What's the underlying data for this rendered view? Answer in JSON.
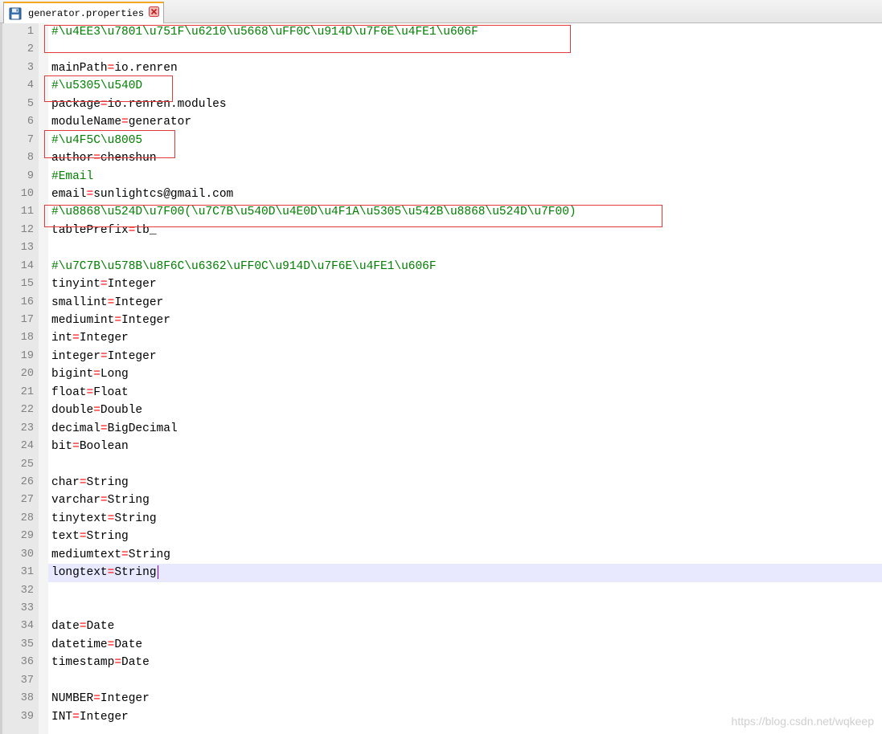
{
  "tab": {
    "title": "generator.properties",
    "save_icon": "floppy-save-icon",
    "close_icon": "close-x-icon"
  },
  "colors": {
    "comment": "#008000",
    "operator": "#ff0000",
    "text": "#000000",
    "line_number": "#808080",
    "current_line": "#e8e8ff",
    "highlight_box": "#e03a3a"
  },
  "lines": [
    {
      "num": "1",
      "kind": "comment",
      "text": "#\\u4EE3\\u7801\\u751F\\u6210\\u5668\\uFF0C\\u914D\\u7F6E\\u4FE1\\u606F"
    },
    {
      "num": "2",
      "kind": "blank",
      "text": ""
    },
    {
      "num": "3",
      "kind": "prop",
      "key": "mainPath",
      "value": "io.renren"
    },
    {
      "num": "4",
      "kind": "comment",
      "text": "#\\u5305\\u540D"
    },
    {
      "num": "5",
      "kind": "prop",
      "key": "package",
      "value": "io.renren.modules"
    },
    {
      "num": "6",
      "kind": "prop",
      "key": "moduleName",
      "value": "generator"
    },
    {
      "num": "7",
      "kind": "comment",
      "text": "#\\u4F5C\\u8005"
    },
    {
      "num": "8",
      "kind": "prop",
      "key": "author",
      "value": "chenshun"
    },
    {
      "num": "9",
      "kind": "comment",
      "text": "#Email"
    },
    {
      "num": "10",
      "kind": "prop",
      "key": "email",
      "value": "sunlightcs@gmail.com"
    },
    {
      "num": "11",
      "kind": "comment",
      "text": "#\\u8868\\u524D\\u7F00(\\u7C7B\\u540D\\u4E0D\\u4F1A\\u5305\\u542B\\u8868\\u524D\\u7F00)"
    },
    {
      "num": "12",
      "kind": "prop",
      "key": "tablePrefix",
      "value": "tb_"
    },
    {
      "num": "13",
      "kind": "blank",
      "text": ""
    },
    {
      "num": "14",
      "kind": "comment",
      "text": "#\\u7C7B\\u578B\\u8F6C\\u6362\\uFF0C\\u914D\\u7F6E\\u4FE1\\u606F"
    },
    {
      "num": "15",
      "kind": "prop",
      "key": "tinyint",
      "value": "Integer"
    },
    {
      "num": "16",
      "kind": "prop",
      "key": "smallint",
      "value": "Integer"
    },
    {
      "num": "17",
      "kind": "prop",
      "key": "mediumint",
      "value": "Integer"
    },
    {
      "num": "18",
      "kind": "prop",
      "key": "int",
      "value": "Integer"
    },
    {
      "num": "19",
      "kind": "prop",
      "key": "integer",
      "value": "Integer"
    },
    {
      "num": "20",
      "kind": "prop",
      "key": "bigint",
      "value": "Long"
    },
    {
      "num": "21",
      "kind": "prop",
      "key": "float",
      "value": "Float"
    },
    {
      "num": "22",
      "kind": "prop",
      "key": "double",
      "value": "Double"
    },
    {
      "num": "23",
      "kind": "prop",
      "key": "decimal",
      "value": "BigDecimal"
    },
    {
      "num": "24",
      "kind": "prop",
      "key": "bit",
      "value": "Boolean"
    },
    {
      "num": "25",
      "kind": "blank",
      "text": ""
    },
    {
      "num": "26",
      "kind": "prop",
      "key": "char",
      "value": "String"
    },
    {
      "num": "27",
      "kind": "prop",
      "key": "varchar",
      "value": "String"
    },
    {
      "num": "28",
      "kind": "prop",
      "key": "tinytext",
      "value": "String"
    },
    {
      "num": "29",
      "kind": "prop",
      "key": "text",
      "value": "String"
    },
    {
      "num": "30",
      "kind": "prop",
      "key": "mediumtext",
      "value": "String"
    },
    {
      "num": "31",
      "kind": "prop",
      "key": "longtext",
      "value": "String",
      "current": true
    },
    {
      "num": "32",
      "kind": "blank",
      "text": ""
    },
    {
      "num": "33",
      "kind": "blank",
      "text": ""
    },
    {
      "num": "34",
      "kind": "prop",
      "key": "date",
      "value": "Date"
    },
    {
      "num": "35",
      "kind": "prop",
      "key": "datetime",
      "value": "Date"
    },
    {
      "num": "36",
      "kind": "prop",
      "key": "timestamp",
      "value": "Date"
    },
    {
      "num": "37",
      "kind": "blank",
      "text": ""
    },
    {
      "num": "38",
      "kind": "prop",
      "key": "NUMBER",
      "value": "Integer"
    },
    {
      "num": "39",
      "kind": "prop",
      "key": "INT",
      "value": "Integer"
    }
  ],
  "watermark": "https://blog.csdn.net/wqkeep"
}
